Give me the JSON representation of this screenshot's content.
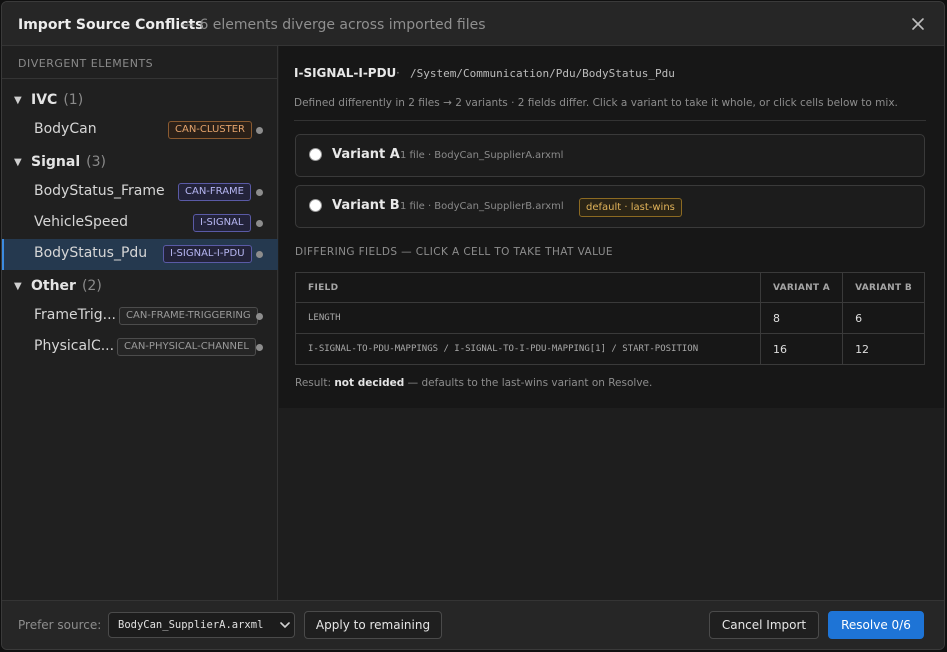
{
  "dialog": {
    "title": "Import Source Conflicts",
    "subtitle": "— 6 elements diverge across imported files",
    "close_icon": "close-icon"
  },
  "sidebar": {
    "header": "DIVERGENT ELEMENTS",
    "groups": [
      {
        "name": "IVC",
        "count": "(1)",
        "items": [
          {
            "label": "BodyCan",
            "tag": "CAN-CLUSTER",
            "tag_color": "#e4a36c"
          }
        ]
      },
      {
        "name": "Signal",
        "count": "(3)",
        "items": [
          {
            "label": "BodyStatus_Frame",
            "tag": "CAN-FRAME",
            "tag_color": "#b6b6f2"
          },
          {
            "label": "VehicleSpeed",
            "tag": "I-SIGNAL",
            "tag_color": "#b6b6f2"
          },
          {
            "label": "BodyStatus_Pdu",
            "tag": "I-SIGNAL-I-PDU",
            "tag_color": "#b6b6f2",
            "selected": true
          }
        ]
      },
      {
        "name": "Other",
        "count": "(2)",
        "items": [
          {
            "label": "FrameTrig...",
            "tag": "CAN-FRAME-TRIGGERING",
            "tag_color": "#9a9a9a"
          },
          {
            "label": "PhysicalC...",
            "tag": "CAN-PHYSICAL-CHANNEL",
            "tag_color": "#9a9a9a"
          }
        ]
      }
    ]
  },
  "main": {
    "element_type": "I-SIGNAL-I-PDU",
    "separator": "·",
    "path": "/System/Communication/Pdu/BodyStatus_Pdu",
    "description": "Defined differently in 2 files → 2 variants · 2 fields differ. Click a variant to take it whole, or click cells below to mix.",
    "variants": [
      {
        "name": "Variant A",
        "meta": "1 file · BodyCan_SupplierA.arxml",
        "badge": ""
      },
      {
        "name": "Variant B",
        "meta": "1 file · BodyCan_SupplierB.arxml",
        "badge": "default · last-wins"
      }
    ],
    "differing_header": "DIFFERING FIELDS — CLICK A CELL TO TAKE THAT VALUE",
    "table": {
      "headers": [
        "FIELD",
        "VARIANT A",
        "VARIANT B"
      ],
      "rows": [
        [
          "LENGTH",
          "8",
          "6"
        ],
        [
          "I-SIGNAL-TO-PDU-MAPPINGS / I-SIGNAL-TO-I-PDU-MAPPING[1] / START-POSITION",
          "16",
          "12"
        ]
      ]
    },
    "result_prefix": "Result:",
    "result_value": "not decided",
    "result_suffix": "— defaults to the last-wins variant on Resolve."
  },
  "footer": {
    "prefer_label": "Prefer source:",
    "prefer_value": "BodyCan_SupplierA.arxml",
    "apply_label": "Apply to remaining",
    "cancel_label": "Cancel Import",
    "resolve_label": "Resolve 0/6"
  },
  "colors": {
    "accent": "#1e74d6",
    "selected_row": "#25394f",
    "badge_default": "#e0b35a"
  }
}
